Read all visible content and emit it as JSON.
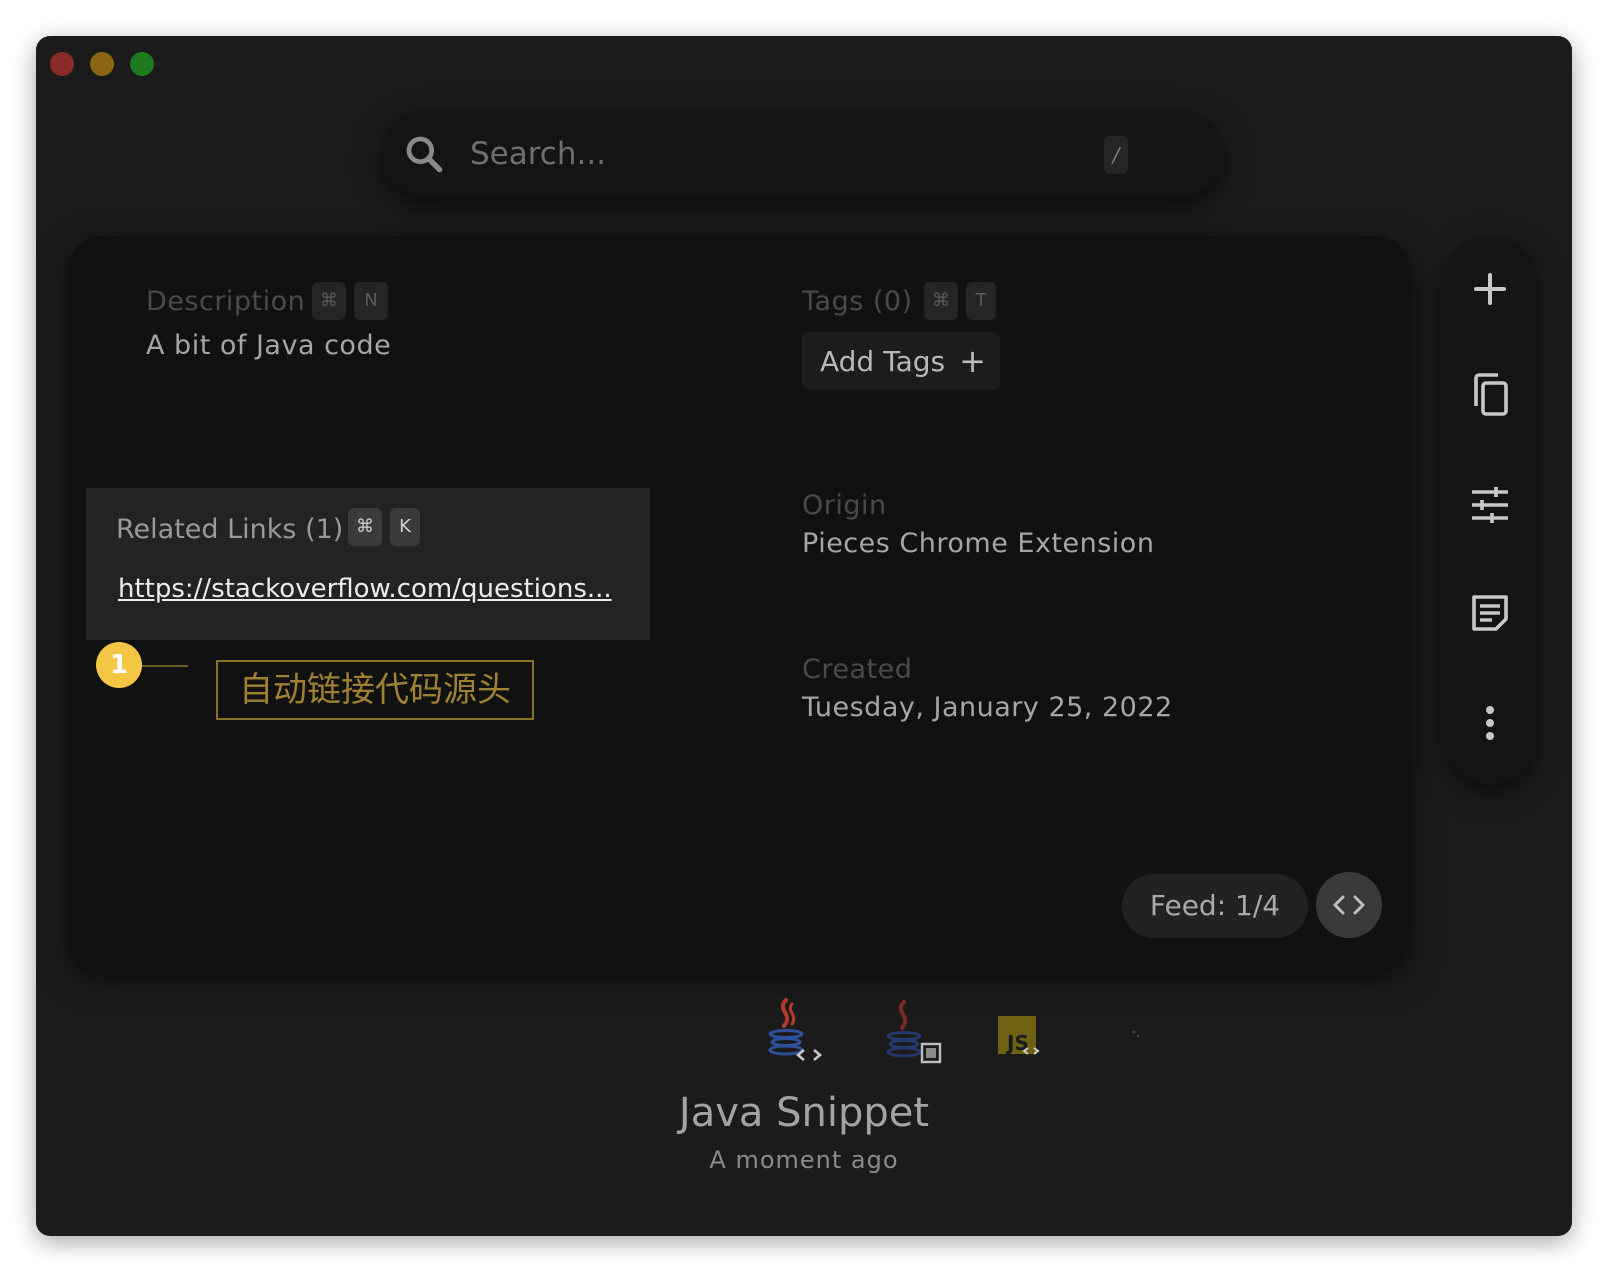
{
  "window": {
    "traffic_lights": [
      "close",
      "minimize",
      "zoom"
    ]
  },
  "search": {
    "placeholder": "Search...",
    "shortcut": "/",
    "icon": "search-icon"
  },
  "details": {
    "description": {
      "label": "Description",
      "keys": [
        "⌘",
        "N"
      ],
      "value": "A bit of Java code"
    },
    "tags": {
      "label": "Tags (0)",
      "keys": [
        "⌘",
        "T"
      ],
      "add_button": "Add Tags",
      "add_icon": "plus-icon"
    },
    "related_links": {
      "label": "Related Links (1)",
      "keys": [
        "⌘",
        "K"
      ],
      "url": "https://stackoverflow.com/questions..."
    },
    "origin": {
      "label": "Origin",
      "value": "Pieces Chrome Extension"
    },
    "created": {
      "label": "Created",
      "value": "Tuesday, January 25, 2022"
    }
  },
  "annotation": {
    "number": "1",
    "text": "自动链接代码源头",
    "color": "#f3c643"
  },
  "feed": {
    "label": "Feed: 1/4",
    "toggle_icon": "code-brackets-icon"
  },
  "side_rail": {
    "icons": [
      "plus-icon",
      "copy-icon",
      "tune-icon",
      "note-icon",
      "more-vertical-icon"
    ]
  },
  "formats": {
    "icons": [
      "java-code-icon",
      "java-screenshot-icon",
      "javascript-code-icon",
      "blank-format-icon"
    ]
  },
  "snippet": {
    "title": "Java Snippet",
    "subtitle": "A moment ago"
  }
}
